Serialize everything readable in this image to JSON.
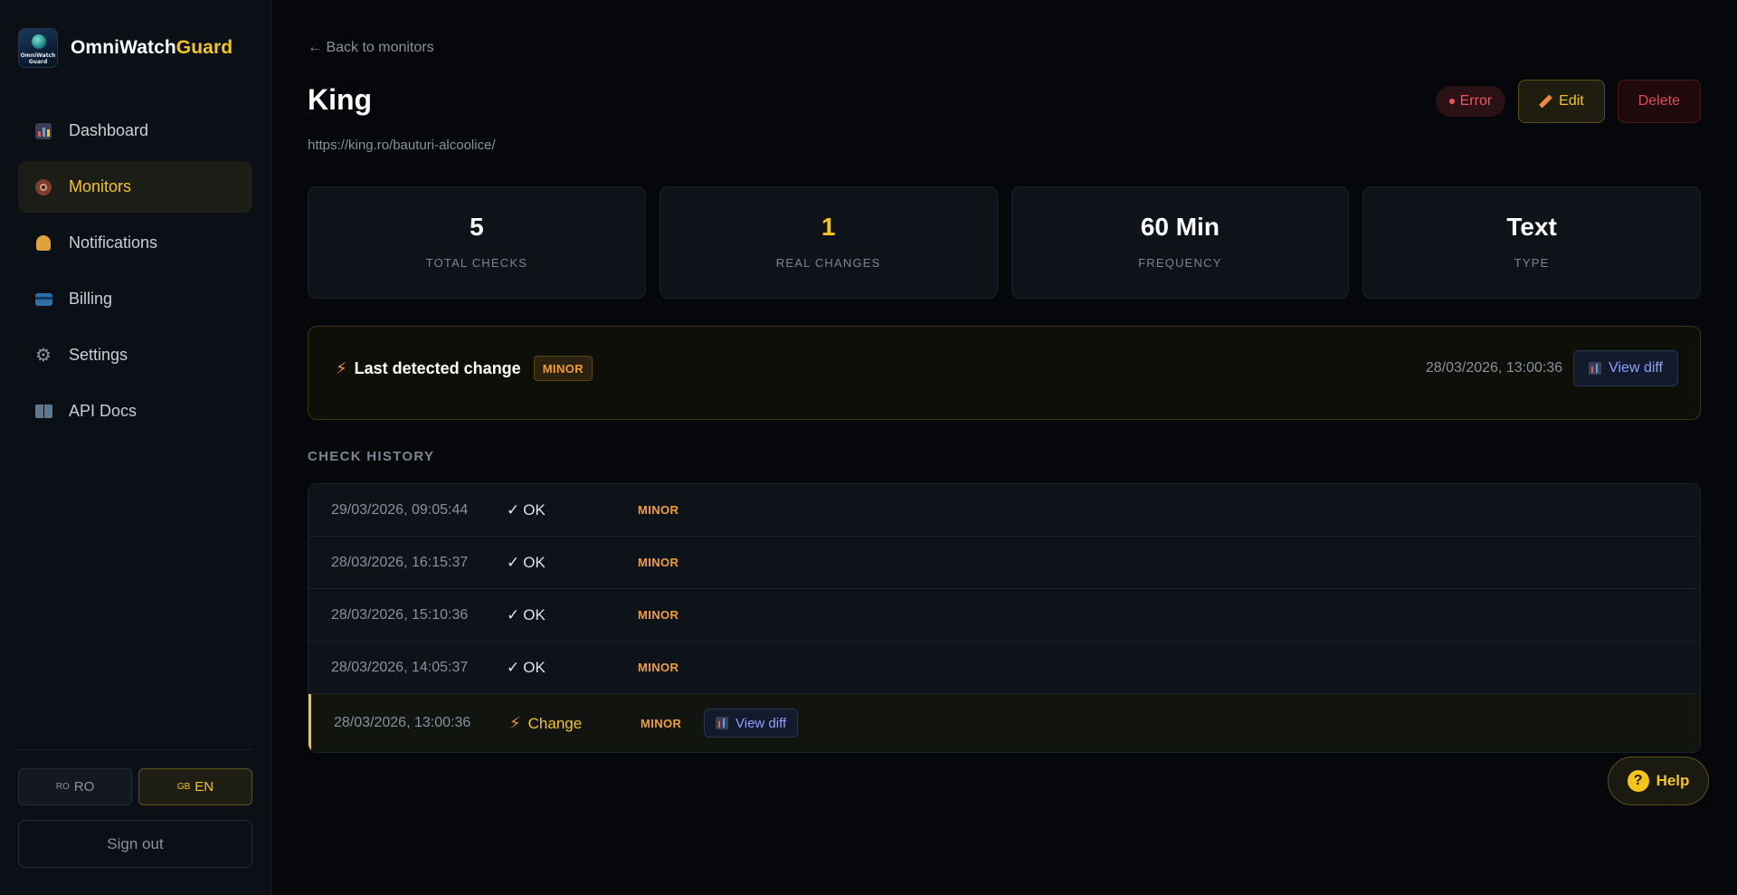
{
  "app": {
    "logo_text": "OmniWatch Guard",
    "brand_primary": "OmniWatch",
    "brand_accent": "Guard",
    "accent_color": "#f5c518"
  },
  "sidebar": {
    "items": [
      {
        "label": "Dashboard",
        "icon": "chart-icon"
      },
      {
        "label": "Monitors",
        "icon": "eye-icon",
        "active": true
      },
      {
        "label": "Notifications",
        "icon": "bell-icon"
      },
      {
        "label": "Billing",
        "icon": "card-icon"
      },
      {
        "label": "Settings",
        "icon": "gear-icon"
      },
      {
        "label": "API Docs",
        "icon": "book-icon"
      }
    ],
    "languages": [
      {
        "flag": "RO",
        "label": "RO",
        "active": false
      },
      {
        "flag": "GB",
        "label": "EN",
        "active": true
      }
    ],
    "sign_out": "Sign out"
  },
  "header": {
    "back_label": "← Back to monitors",
    "title": "King",
    "url": "https://king.ro/bauturi-alcoolice/",
    "status": "Error",
    "edit_label": "Edit",
    "delete_label": "Delete"
  },
  "stats": [
    {
      "value": "5",
      "label": "TOTAL CHECKS"
    },
    {
      "value": "1",
      "label": "REAL CHANGES"
    },
    {
      "value": "60 Min",
      "label": "FREQUENCY"
    },
    {
      "value": "Text",
      "label": "TYPE"
    }
  ],
  "last_change": {
    "title": "Last detected change",
    "severity": "MINOR",
    "date": "28/03/2026, 13:00:36",
    "view_diff": "View diff"
  },
  "history": {
    "title": "CHECK HISTORY",
    "rows": [
      {
        "date": "29/03/2026, 09:05:44",
        "status": "OK",
        "severity": "MINOR"
      },
      {
        "date": "28/03/2026, 16:15:37",
        "status": "OK",
        "severity": "MINOR"
      },
      {
        "date": "28/03/2026, 15:10:36",
        "status": "OK",
        "severity": "MINOR"
      },
      {
        "date": "28/03/2026, 14:05:37",
        "status": "OK",
        "severity": "MINOR"
      },
      {
        "date": "28/03/2026, 13:00:36",
        "status": "Change",
        "severity": "MINOR",
        "view_diff": "View diff"
      }
    ]
  },
  "help_label": "Help"
}
